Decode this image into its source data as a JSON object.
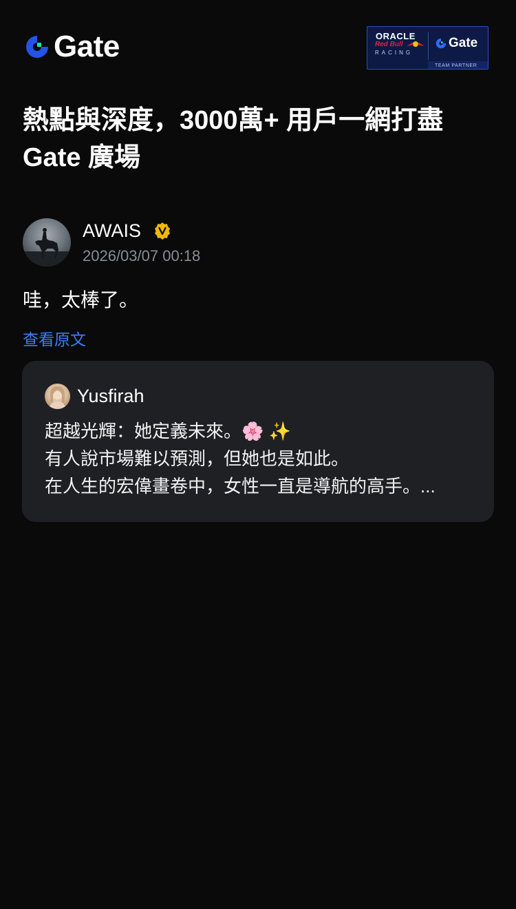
{
  "header": {
    "brand": "Gate",
    "partner_badge": {
      "oracle": "ORACLE",
      "redbull": "Red Bull",
      "racing": "RACING",
      "gate": "Gate",
      "team_partner": "TEAM PARTNER"
    }
  },
  "headline": {
    "line1": "熱點與深度，3000萬+ 用戶一網打盡",
    "line2": "Gate 廣場"
  },
  "post": {
    "author": "AWAIS",
    "timestamp": "2026/03/07 00:18",
    "text": "哇，太棒了。",
    "translate_link": "查看原文"
  },
  "quote": {
    "author": "Yusfirah",
    "lines": [
      "超越光輝：她定義未來。🌸 ✨",
      "有人說市場難以預測，但她也是如此。",
      "在人生的宏偉畫卷中，女性一直是導航的高手。..."
    ]
  },
  "colors": {
    "background": "#0a0a0b",
    "card": "#1f2024",
    "link": "#3c7df5",
    "verified": "#f0b90b",
    "muted": "#8a8d93"
  }
}
